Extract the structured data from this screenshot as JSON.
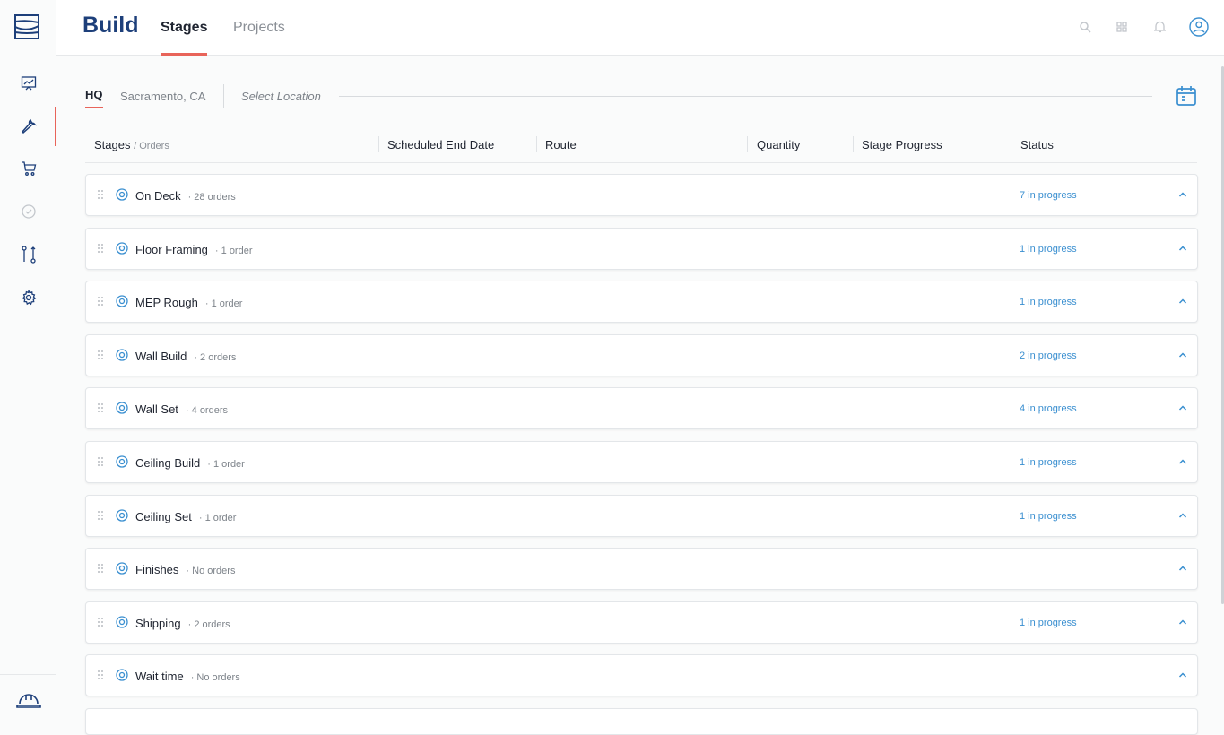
{
  "app": {
    "title": "Build"
  },
  "tabs": [
    {
      "label": "Stages",
      "active": true
    },
    {
      "label": "Projects",
      "active": false
    }
  ],
  "location": {
    "hq": "HQ",
    "city": "Sacramento, CA",
    "placeholder": "Select Location"
  },
  "columns": {
    "stages": "Stages",
    "orders": "/ Orders",
    "scheduled_end": "Scheduled End Date",
    "route": "Route",
    "quantity": "Quantity",
    "progress": "Stage Progress",
    "status": "Status"
  },
  "stages": [
    {
      "name": "On Deck",
      "count": "· 28 orders",
      "status": "7 in progress"
    },
    {
      "name": "Floor Framing",
      "count": "· 1 order",
      "status": "1 in progress"
    },
    {
      "name": "MEP Rough",
      "count": "· 1 order",
      "status": "1 in progress"
    },
    {
      "name": "Wall Build",
      "count": "· 2 orders",
      "status": "2 in progress"
    },
    {
      "name": "Wall Set",
      "count": "· 4 orders",
      "status": "4 in progress"
    },
    {
      "name": "Ceiling Build",
      "count": "· 1 order",
      "status": "1 in progress"
    },
    {
      "name": "Ceiling Set",
      "count": "· 1 order",
      "status": "1 in progress"
    },
    {
      "name": "Finishes",
      "count": "· No orders",
      "status": ""
    },
    {
      "name": "Shipping",
      "count": "· 2 orders",
      "status": "1 in progress"
    },
    {
      "name": "Wait time",
      "count": "· No orders",
      "status": ""
    }
  ],
  "icons": {
    "logo": "brand-logo-icon",
    "nav": [
      "dashboard-icon",
      "wrench-icon",
      "cart-icon",
      "check-circle-icon",
      "route-icon",
      "gear-icon"
    ],
    "nav_active": "wrench-icon",
    "top": [
      "search-icon",
      "grid-icon",
      "bell-icon",
      "user-icon"
    ],
    "bottom": "hardhat-icon",
    "calendar": "calendar-icon"
  },
  "colors": {
    "brand": "#1d3f7a",
    "accent": "#e8645a",
    "link": "#3a8fd0"
  }
}
